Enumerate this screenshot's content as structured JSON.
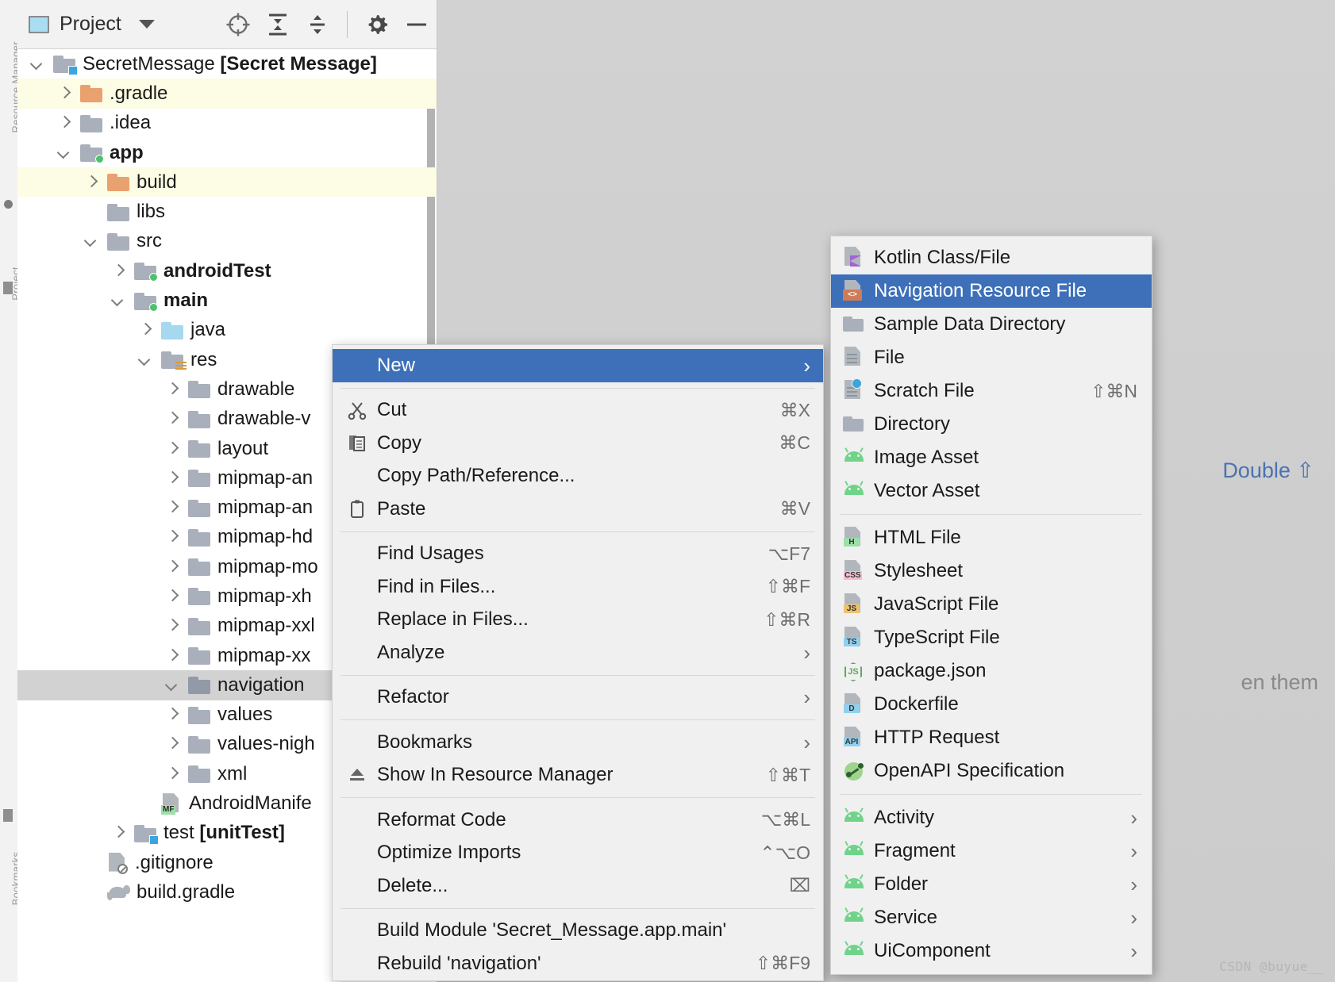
{
  "window": {
    "tool_window_title": "Project",
    "header_icons": [
      "project-select-icon",
      "locate-icon",
      "expand-all-icon",
      "collapse-all-icon",
      "settings-gear-icon",
      "hide-icon"
    ]
  },
  "edge_strip": {
    "labels": [
      "Resource Manager",
      "Project",
      "Bookmarks"
    ]
  },
  "tree": [
    {
      "label": "SecretMessage ",
      "bold_suffix": "[Secret Message]",
      "indent": 0,
      "arrow": "down",
      "icon": "module-folder-blue-badge",
      "state": "normal"
    },
    {
      "label": ".gradle",
      "indent": 1,
      "arrow": "right",
      "icon": "folder-orange",
      "state": "highlight"
    },
    {
      "label": ".idea",
      "indent": 1,
      "arrow": "right",
      "icon": "folder-gray",
      "state": "normal"
    },
    {
      "label": "app",
      "indent": 1,
      "arrow": "down",
      "icon": "module-folder-green-badge",
      "state": "normal",
      "bold": true
    },
    {
      "label": "build",
      "indent": 2,
      "arrow": "right",
      "icon": "folder-orange",
      "state": "highlight"
    },
    {
      "label": "libs",
      "indent": 2,
      "arrow": "none",
      "icon": "folder-gray",
      "state": "normal"
    },
    {
      "label": "src",
      "indent": 2,
      "arrow": "down",
      "icon": "folder-gray",
      "state": "normal"
    },
    {
      "label": "androidTest",
      "indent": 3,
      "arrow": "right",
      "icon": "module-folder-green-badge",
      "state": "normal",
      "bold": true
    },
    {
      "label": "main",
      "indent": 3,
      "arrow": "down",
      "icon": "module-folder-green-badge",
      "state": "normal",
      "bold": true
    },
    {
      "label": "java",
      "indent": 4,
      "arrow": "right",
      "icon": "folder-blue",
      "state": "normal"
    },
    {
      "label": "res",
      "indent": 4,
      "arrow": "down",
      "icon": "folder-res-badge",
      "state": "normal"
    },
    {
      "label": "drawable",
      "indent": 5,
      "arrow": "right",
      "icon": "folder-gray",
      "state": "normal"
    },
    {
      "label": "drawable-v",
      "indent": 5,
      "arrow": "right",
      "icon": "folder-gray",
      "state": "normal"
    },
    {
      "label": "layout",
      "indent": 5,
      "arrow": "right",
      "icon": "folder-gray",
      "state": "normal"
    },
    {
      "label": "mipmap-an",
      "indent": 5,
      "arrow": "right",
      "icon": "folder-gray",
      "state": "normal"
    },
    {
      "label": "mipmap-an",
      "indent": 5,
      "arrow": "right",
      "icon": "folder-gray",
      "state": "normal"
    },
    {
      "label": "mipmap-hd",
      "indent": 5,
      "arrow": "right",
      "icon": "folder-gray",
      "state": "normal"
    },
    {
      "label": "mipmap-mo",
      "indent": 5,
      "arrow": "right",
      "icon": "folder-gray",
      "state": "normal"
    },
    {
      "label": "mipmap-xh",
      "indent": 5,
      "arrow": "right",
      "icon": "folder-gray",
      "state": "normal"
    },
    {
      "label": "mipmap-xxl",
      "indent": 5,
      "arrow": "right",
      "icon": "folder-gray",
      "state": "normal"
    },
    {
      "label": "mipmap-xx",
      "indent": 5,
      "arrow": "right",
      "icon": "folder-gray",
      "state": "normal"
    },
    {
      "label": "navigation",
      "indent": 5,
      "arrow": "down",
      "icon": "folder-dark",
      "state": "selected"
    },
    {
      "label": "values",
      "indent": 5,
      "arrow": "right",
      "icon": "folder-gray",
      "state": "normal"
    },
    {
      "label": "values-nigh",
      "indent": 5,
      "arrow": "right",
      "icon": "folder-gray",
      "state": "normal"
    },
    {
      "label": "xml",
      "indent": 5,
      "arrow": "right",
      "icon": "folder-gray",
      "state": "normal"
    },
    {
      "label": "AndroidManife",
      "indent": 4,
      "arrow": "none",
      "icon": "manifest-file-icon",
      "state": "normal"
    },
    {
      "label": "test ",
      "bold_suffix": "[unitTest]",
      "indent": 3,
      "arrow": "right",
      "icon": "module-folder-blue-badge",
      "state": "normal"
    },
    {
      "label": ".gitignore",
      "indent": 2,
      "arrow": "none",
      "icon": "gitignore-file-icon",
      "state": "normal"
    },
    {
      "label": "build.gradle",
      "indent": 2,
      "arrow": "none",
      "icon": "gradle-elephant-icon",
      "state": "normal"
    }
  ],
  "context_menu": [
    {
      "type": "item",
      "label": "New",
      "icon": null,
      "shortcut": "",
      "submark": "›",
      "active": true,
      "name": "menu-item-new"
    },
    {
      "type": "sep"
    },
    {
      "type": "item",
      "label": "Cut",
      "icon": "scissors-icon",
      "shortcut": "⌘X",
      "name": "menu-item-cut"
    },
    {
      "type": "item",
      "label": "Copy",
      "icon": "copy-icon",
      "shortcut": "⌘C",
      "name": "menu-item-copy"
    },
    {
      "type": "item",
      "label": "Copy Path/Reference...",
      "icon": null,
      "shortcut": "",
      "name": "menu-item-copy-path"
    },
    {
      "type": "item",
      "label": "Paste",
      "icon": "clipboard-icon",
      "shortcut": "⌘V",
      "name": "menu-item-paste"
    },
    {
      "type": "sep"
    },
    {
      "type": "item",
      "label": "Find Usages",
      "icon": null,
      "shortcut": "⌥F7",
      "name": "menu-item-find-usages"
    },
    {
      "type": "item",
      "label": "Find in Files...",
      "icon": null,
      "shortcut": "⇧⌘F",
      "name": "menu-item-find-in-files"
    },
    {
      "type": "item",
      "label": "Replace in Files...",
      "icon": null,
      "shortcut": "⇧⌘R",
      "name": "menu-item-replace-in-files"
    },
    {
      "type": "item",
      "label": "Analyze",
      "icon": null,
      "shortcut": "",
      "submark": "›",
      "name": "menu-item-analyze"
    },
    {
      "type": "sep"
    },
    {
      "type": "item",
      "label": "Refactor",
      "icon": null,
      "shortcut": "",
      "submark": "›",
      "name": "menu-item-refactor"
    },
    {
      "type": "sep"
    },
    {
      "type": "item",
      "label": "Bookmarks",
      "icon": null,
      "shortcut": "",
      "submark": "›",
      "name": "menu-item-bookmarks"
    },
    {
      "type": "item",
      "label": "Show In Resource Manager",
      "icon": "resource-manager-icon",
      "shortcut": "⇧⌘T",
      "name": "menu-item-show-in-resource-manager"
    },
    {
      "type": "sep"
    },
    {
      "type": "item",
      "label": "Reformat Code",
      "icon": null,
      "shortcut": "⌥⌘L",
      "name": "menu-item-reformat-code"
    },
    {
      "type": "item",
      "label": "Optimize Imports",
      "icon": null,
      "shortcut": "⌃⌥O",
      "name": "menu-item-optimize-imports"
    },
    {
      "type": "item",
      "label": "Delete...",
      "icon": null,
      "shortcut": "⌧",
      "name": "menu-item-delete"
    },
    {
      "type": "sep"
    },
    {
      "type": "item",
      "label": "Build Module 'Secret_Message.app.main'",
      "icon": null,
      "shortcut": "",
      "name": "menu-item-build-module"
    },
    {
      "type": "item",
      "label": "Rebuild 'navigation'",
      "icon": null,
      "shortcut": "⇧⌘F9",
      "name": "menu-item-rebuild-navigation"
    }
  ],
  "submenu": [
    {
      "type": "item",
      "label": "Kotlin Class/File",
      "icon": "kotlin-file-icon",
      "shortcut": "",
      "name": "new-kotlin-class-file"
    },
    {
      "type": "item",
      "label": "Navigation Resource File",
      "icon": "navigation-resource-icon",
      "shortcut": "",
      "active": true,
      "name": "new-navigation-resource-file"
    },
    {
      "type": "item",
      "label": "Sample Data Directory",
      "icon": "folder-icon",
      "shortcut": "",
      "name": "new-sample-data-directory"
    },
    {
      "type": "item",
      "label": "File",
      "icon": "file-icon",
      "shortcut": "",
      "name": "new-file"
    },
    {
      "type": "item",
      "label": "Scratch File",
      "icon": "scratch-file-icon",
      "shortcut": "⇧⌘N",
      "name": "new-scratch-file"
    },
    {
      "type": "item",
      "label": "Directory",
      "icon": "folder-icon",
      "shortcut": "",
      "name": "new-directory"
    },
    {
      "type": "item",
      "label": "Image Asset",
      "icon": "android-icon",
      "shortcut": "",
      "name": "new-image-asset"
    },
    {
      "type": "item",
      "label": "Vector Asset",
      "icon": "android-icon",
      "shortcut": "",
      "name": "new-vector-asset"
    },
    {
      "type": "sep"
    },
    {
      "type": "item",
      "label": "HTML File",
      "icon": "html-file-icon",
      "shortcut": "",
      "name": "new-html-file"
    },
    {
      "type": "item",
      "label": "Stylesheet",
      "icon": "css-file-icon",
      "shortcut": "",
      "name": "new-stylesheet"
    },
    {
      "type": "item",
      "label": "JavaScript File",
      "icon": "js-file-icon",
      "shortcut": "",
      "name": "new-javascript-file"
    },
    {
      "type": "item",
      "label": "TypeScript File",
      "icon": "ts-file-icon",
      "shortcut": "",
      "name": "new-typescript-file"
    },
    {
      "type": "item",
      "label": "package.json",
      "icon": "nodejs-icon",
      "shortcut": "",
      "name": "new-package-json"
    },
    {
      "type": "item",
      "label": "Dockerfile",
      "icon": "dockerfile-icon",
      "shortcut": "",
      "name": "new-dockerfile"
    },
    {
      "type": "item",
      "label": "HTTP Request",
      "icon": "http-request-icon",
      "shortcut": "",
      "name": "new-http-request"
    },
    {
      "type": "item",
      "label": "OpenAPI Specification",
      "icon": "openapi-icon",
      "shortcut": "",
      "name": "new-openapi-specification"
    },
    {
      "type": "sep"
    },
    {
      "type": "item",
      "label": "Activity",
      "icon": "android-icon",
      "submark": "›",
      "name": "new-activity"
    },
    {
      "type": "item",
      "label": "Fragment",
      "icon": "android-icon",
      "submark": "›",
      "name": "new-fragment"
    },
    {
      "type": "item",
      "label": "Folder",
      "icon": "android-icon",
      "submark": "›",
      "name": "new-folder"
    },
    {
      "type": "item",
      "label": "Service",
      "icon": "android-icon",
      "submark": "›",
      "name": "new-service"
    },
    {
      "type": "item",
      "label": "UiComponent",
      "icon": "android-icon",
      "submark": "›",
      "name": "new-uicomponent"
    }
  ],
  "editor": {
    "hint_line_1": "Double ⇧",
    "hint_line_2": "en them"
  },
  "watermark": "CSDN @buyue__",
  "colors": {
    "accent_selection": "#3d70b8",
    "highlight_row": "#fdfce4",
    "selected_row": "#d2d2d2",
    "editor_bg": "#cfcfcf"
  }
}
